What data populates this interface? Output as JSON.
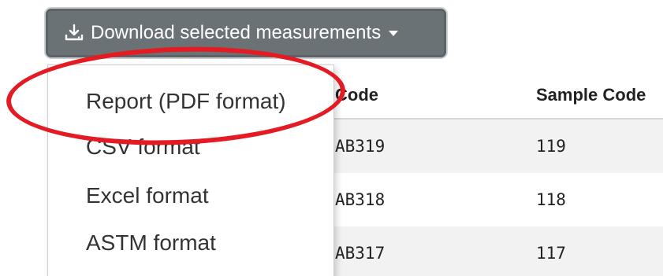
{
  "toolbar": {
    "download_label": "Download selected measurements",
    "download_icon": "download-icon"
  },
  "table": {
    "headers": {
      "code": "Code",
      "sample_code": "Sample Code"
    },
    "rows": [
      {
        "code": "AB319",
        "sample_code": "119"
      },
      {
        "code": "AB318",
        "sample_code": "118"
      },
      {
        "code": "AB317",
        "sample_code": "117"
      }
    ]
  },
  "dropdown": {
    "items": [
      {
        "label": "Report (PDF format)"
      },
      {
        "label": "CSV format"
      },
      {
        "label": "Excel format"
      },
      {
        "label": "ASTM format"
      }
    ]
  },
  "annotation": {
    "color": "#e41b23"
  }
}
